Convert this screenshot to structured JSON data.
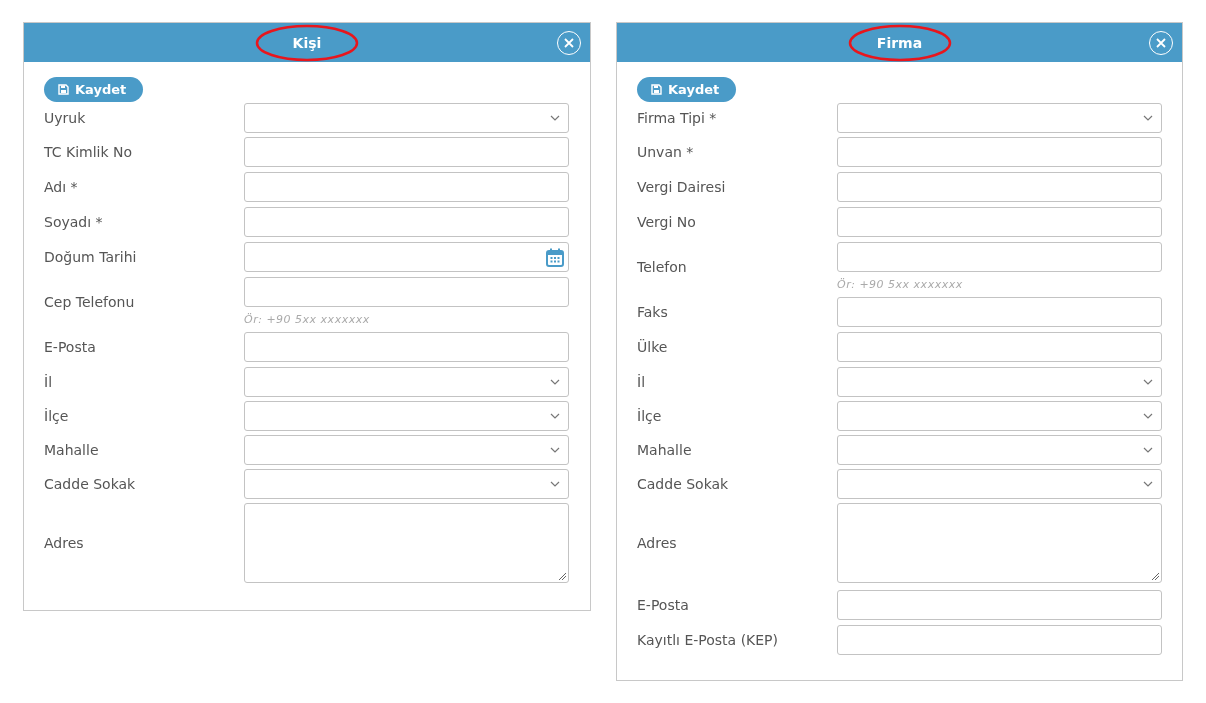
{
  "dialogs": [
    {
      "title": "Kişi",
      "title_circled": true,
      "save_button": "Kaydet",
      "fields": [
        {
          "label": "Uyruk",
          "kind": "select"
        },
        {
          "label": "TC Kimlik No",
          "kind": "text"
        },
        {
          "label": "Adı *",
          "kind": "text"
        },
        {
          "label": "Soyadı *",
          "kind": "text"
        },
        {
          "label": "Doğum Tarihi",
          "kind": "date"
        },
        {
          "label": "Cep Telefonu",
          "kind": "text",
          "hint": "Ör: +90 5xx xxxxxxx"
        },
        {
          "label": "E-Posta",
          "kind": "text"
        },
        {
          "label": "İl",
          "kind": "select"
        },
        {
          "label": "İlçe",
          "kind": "select"
        },
        {
          "label": "Mahalle",
          "kind": "select"
        },
        {
          "label": "Cadde Sokak",
          "kind": "select"
        },
        {
          "label": "Adres",
          "kind": "textarea"
        }
      ]
    },
    {
      "title": "Firma",
      "title_circled": true,
      "save_button": "Kaydet",
      "fields": [
        {
          "label": "Firma Tipi *",
          "kind": "select"
        },
        {
          "label": "Unvan *",
          "kind": "text"
        },
        {
          "label": "Vergi Dairesi",
          "kind": "text"
        },
        {
          "label": "Vergi No",
          "kind": "text"
        },
        {
          "label": "Telefon",
          "kind": "text",
          "hint": "Ör: +90 5xx xxxxxxx"
        },
        {
          "label": "Faks",
          "kind": "text"
        },
        {
          "label": "Ülke",
          "kind": "text"
        },
        {
          "label": "İl",
          "kind": "select"
        },
        {
          "label": "İlçe",
          "kind": "select"
        },
        {
          "label": "Mahalle",
          "kind": "select"
        },
        {
          "label": "Cadde Sokak",
          "kind": "select"
        },
        {
          "label": "Adres",
          "kind": "textarea"
        },
        {
          "label": "E-Posta",
          "kind": "text"
        },
        {
          "label": "Kayıtlı E-Posta (KEP)",
          "kind": "text"
        }
      ]
    }
  ]
}
